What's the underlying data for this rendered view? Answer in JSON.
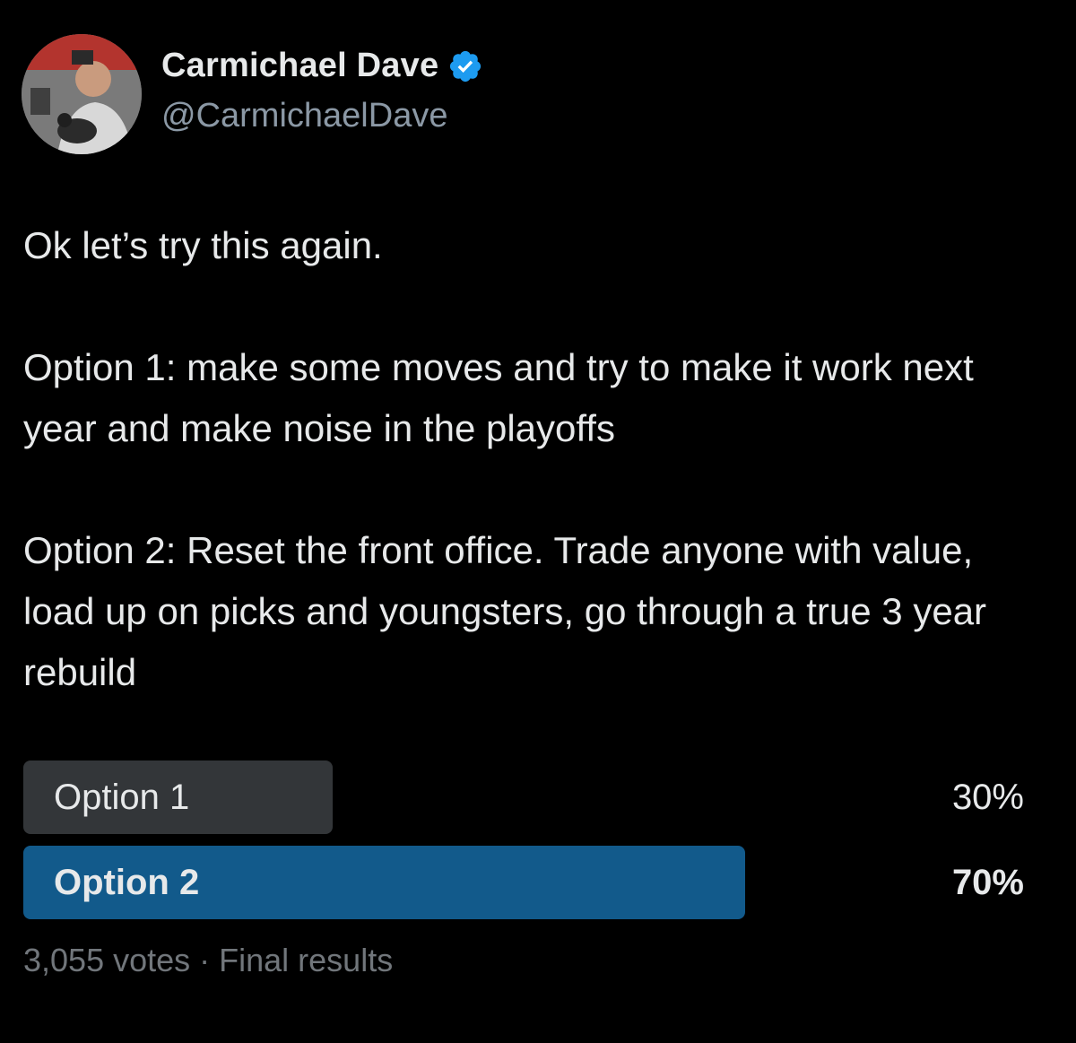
{
  "author": {
    "display_name": "Carmichael Dave",
    "handle": "@CarmichaelDave",
    "verified": true,
    "avatar_icon": "profile-photo",
    "verified_icon": "verified-badge-icon",
    "verified_color": "#1d9bf0"
  },
  "tweet": {
    "paragraphs": [
      "Ok let’s try this again.",
      "Option 1: make some moves and try to make it work next year and make noise in the playoffs",
      "Option 2: Reset the front office. Trade anyone with value, load up on picks and youngsters, go through a true 3 year rebuild"
    ]
  },
  "poll": {
    "options": [
      {
        "label": "Option 1",
        "percent_text": "30%",
        "fraction": 0.3,
        "winner": false,
        "color": "#333639"
      },
      {
        "label": "Option 2",
        "percent_text": "70%",
        "fraction": 0.7,
        "winner": true,
        "color": "#125a8b"
      }
    ],
    "votes": "3,055 votes",
    "separator": " · ",
    "status": "Final results"
  },
  "colors": {
    "background": "#000000",
    "text": "#e7e9ea",
    "secondary_text": "#8b98a5",
    "muted_text": "#71767b"
  }
}
